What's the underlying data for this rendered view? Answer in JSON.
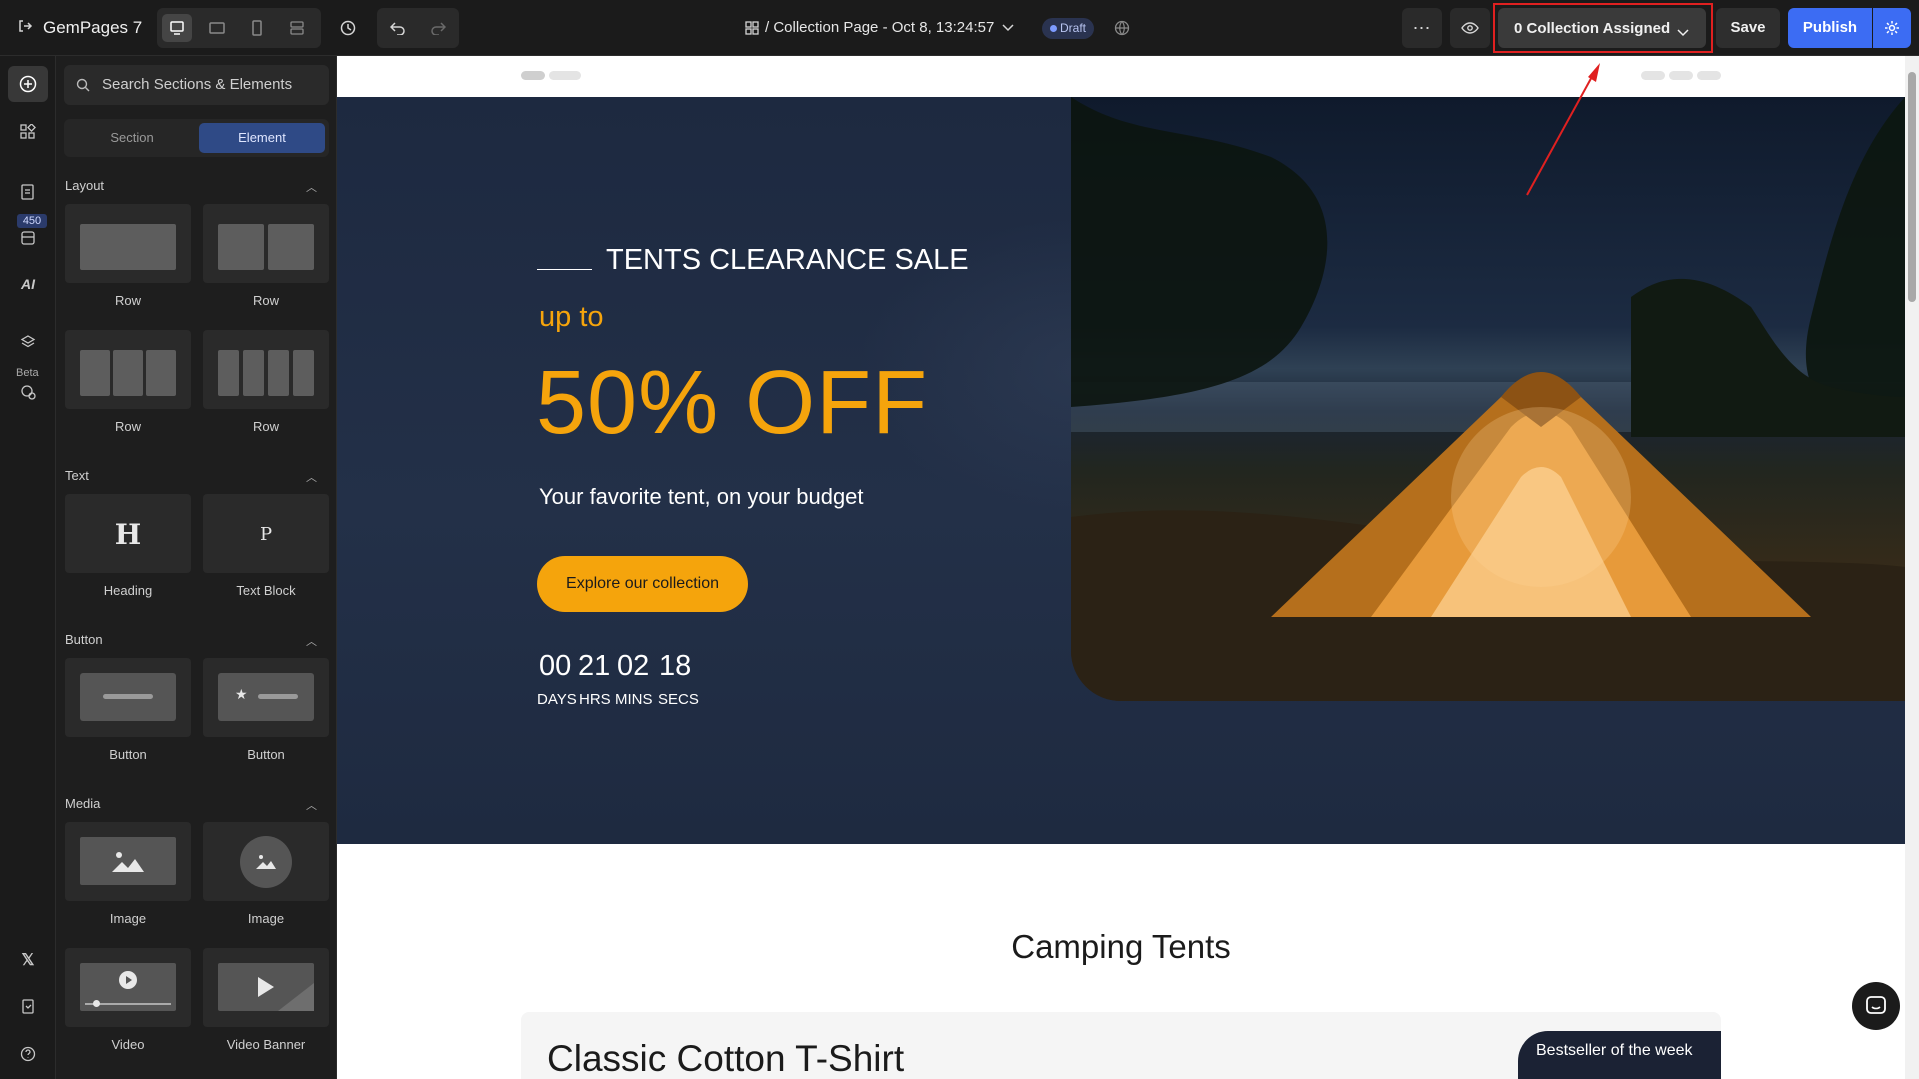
{
  "app": {
    "name": "GemPages 7"
  },
  "toolbar": {
    "page_title": "/ Collection Page - Oct 8, 13:24:57",
    "status_badge": "Draft",
    "collection_dropdown": "0 Collection Assigned",
    "save_label": "Save",
    "publish_label": "Publish"
  },
  "rail": {
    "badge_count": "450",
    "ai_label": "AI",
    "beta_label": "Beta"
  },
  "panel": {
    "search_placeholder": "Search Sections & Elements",
    "tabs": [
      "Section",
      "Element"
    ],
    "active_tab": "Element",
    "groups": {
      "layout": {
        "title": "Layout",
        "items": [
          "Row",
          "Row",
          "Row",
          "Row"
        ]
      },
      "text": {
        "title": "Text",
        "items": [
          "Heading",
          "Text Block"
        ],
        "glyphs": [
          "H",
          "P"
        ]
      },
      "button": {
        "title": "Button",
        "items": [
          "Button",
          "Button"
        ]
      },
      "media": {
        "title": "Media",
        "items": [
          "Image",
          "Image",
          "Video",
          "Video Banner"
        ]
      }
    }
  },
  "hero": {
    "eyebrow": "TENTS CLEARANCE SALE",
    "upto": "up to",
    "headline": "50% OFF",
    "subtitle": "Your favorite tent, on your budget",
    "cta": "Explore our collection",
    "countdown": {
      "values": [
        "00",
        "21",
        "02",
        "18"
      ],
      "labels": [
        "DAYS",
        "HRS",
        "MINS",
        "SECS"
      ]
    }
  },
  "section": {
    "title": "Camping Tents",
    "product_title": "Classic Cotton T-Shirt",
    "badge": "Bestseller of the week"
  },
  "colors": {
    "accent": "#f5a40c",
    "publish": "#3c6cf3",
    "hero_bg": "#1e2a40",
    "annotation": "#e02020"
  }
}
